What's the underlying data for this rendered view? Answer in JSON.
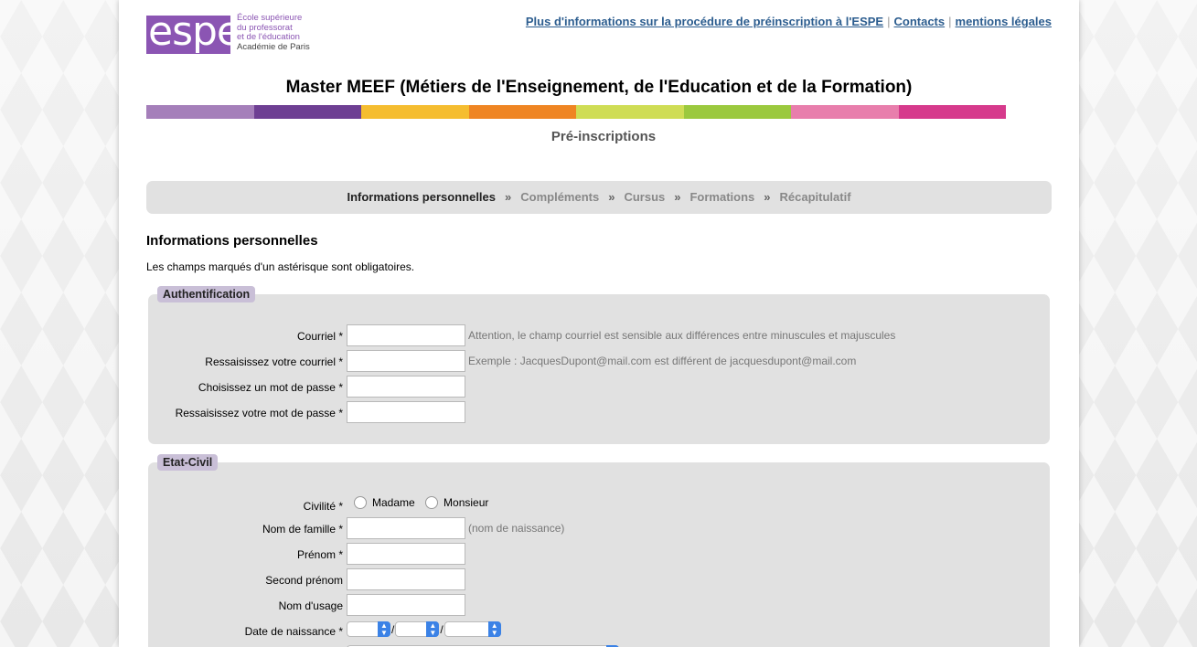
{
  "header": {
    "logo_word": "espe",
    "logo_lines": [
      "École supérieure",
      "du professorat",
      "et de l'éducation"
    ],
    "logo_academy": "Académie de Paris",
    "links": {
      "info": "Plus d'informations sur la procédure de préinscription à l'ESPE",
      "contacts": "Contacts",
      "legal": "mentions légales",
      "separator": "|"
    },
    "title": "Master MEEF (Métiers de l'Enseignement, de l'Education et de la Formation)",
    "colorbar": [
      "#a57fba",
      "#6e3f93",
      "#f5bd30",
      "#ef8523",
      "#cfdd55",
      "#9bc93e",
      "#e87eac",
      "#d63a8c"
    ],
    "subtitle": "Pré-inscriptions"
  },
  "steps": {
    "items": [
      "Informations personnelles",
      "Compléments",
      "Cursus",
      "Formations",
      "Récapitulatif"
    ],
    "separator": "»",
    "current": "Informations personnelles"
  },
  "section": {
    "title": "Informations personnelles",
    "note": "Les champs marqués d'un astérisque sont obligatoires."
  },
  "auth": {
    "legend": "Authentification",
    "email_label": "Courriel *",
    "email_hint": "Attention, le champ courriel est sensible aux différences entre minuscules et majuscules",
    "email_confirm_label": "Ressaisissez votre courriel *",
    "email_confirm_hint": "Exemple : JacquesDupont@mail.com est différent de jacquesdupont@mail.com",
    "password_label": "Choisissez un mot de passe *",
    "password_confirm_label": "Ressaisissez votre mot de passe *"
  },
  "etat_civil": {
    "legend": "Etat-Civil",
    "civility_label": "Civilité *",
    "civility_options": [
      "Madame",
      "Monsieur"
    ],
    "family_name_label": "Nom de famille *",
    "family_name_hint": "(nom de naissance)",
    "first_name_label": "Prénom *",
    "second_first_name_label": "Second prénom",
    "usage_name_label": "Nom d'usage",
    "birth_date_label": "Date de naissance *",
    "date_separator": "/"
  }
}
